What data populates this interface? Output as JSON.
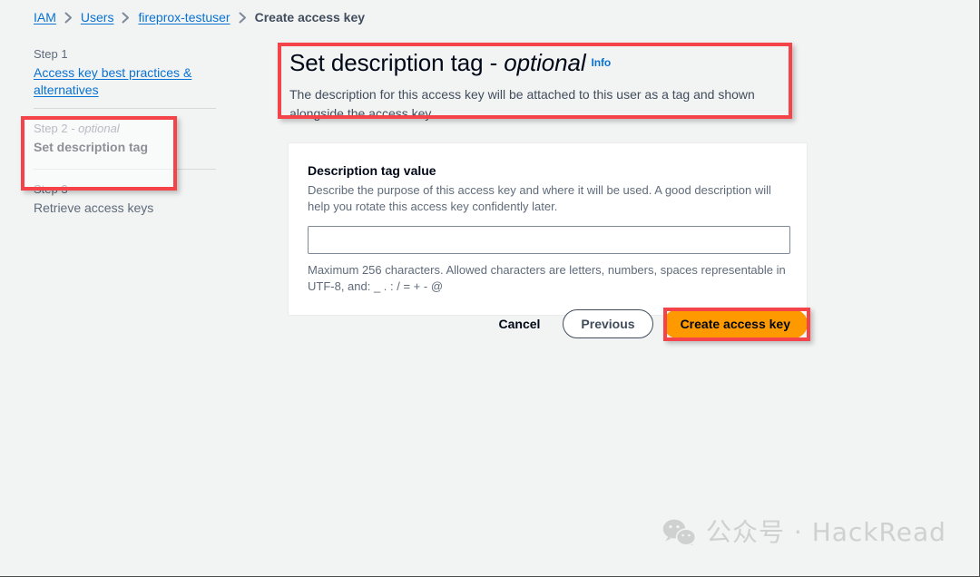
{
  "breadcrumb": {
    "items": [
      {
        "label": "IAM",
        "type": "link"
      },
      {
        "label": "Users",
        "type": "link"
      },
      {
        "label": "fireprox-testuser",
        "type": "link"
      },
      {
        "label": "Create access key",
        "type": "current"
      }
    ],
    "separator_icon": "chevron-right-icon"
  },
  "steps": [
    {
      "label": "Step 1",
      "optional_suffix": "",
      "title": "Access key best practices & alternatives",
      "state": "link"
    },
    {
      "label": "Step 2",
      "optional_suffix": " - optional",
      "title": "Set description tag",
      "state": "active"
    },
    {
      "label": "Step 3",
      "optional_suffix": "",
      "title": "Retrieve access keys",
      "state": "upcoming"
    }
  ],
  "heading": {
    "title": "Set description tag - ",
    "title_italic": "optional",
    "info_label": "Info",
    "description": "The description for this access key will be attached to this user as a tag and shown alongside the access key."
  },
  "form": {
    "field_label": "Description tag value",
    "field_description": "Describe the purpose of this access key and where it will be used. A good description will help you rotate this access key confidently later.",
    "input_value": "",
    "input_placeholder": "",
    "constraint_text": "Maximum 256 characters. Allowed characters are letters, numbers, spaces representable in UTF-8, and: _ . : / = + - @"
  },
  "actions": {
    "cancel_label": "Cancel",
    "previous_label": "Previous",
    "create_label": "Create access key"
  },
  "watermark": {
    "icon": "wechat-icon",
    "text": "公众号 · HackRead"
  },
  "colors": {
    "page_background": "#f2f3f3",
    "link_blue": "#0972d3",
    "text_primary": "#000716",
    "text_secondary": "#5f6b7a",
    "primary_button_orange": "#ff9900",
    "annotation_red": "#f5434a",
    "card_background": "#ffffff",
    "card_border": "#e9ebed",
    "watermark_gray": "#cfd0d0"
  }
}
